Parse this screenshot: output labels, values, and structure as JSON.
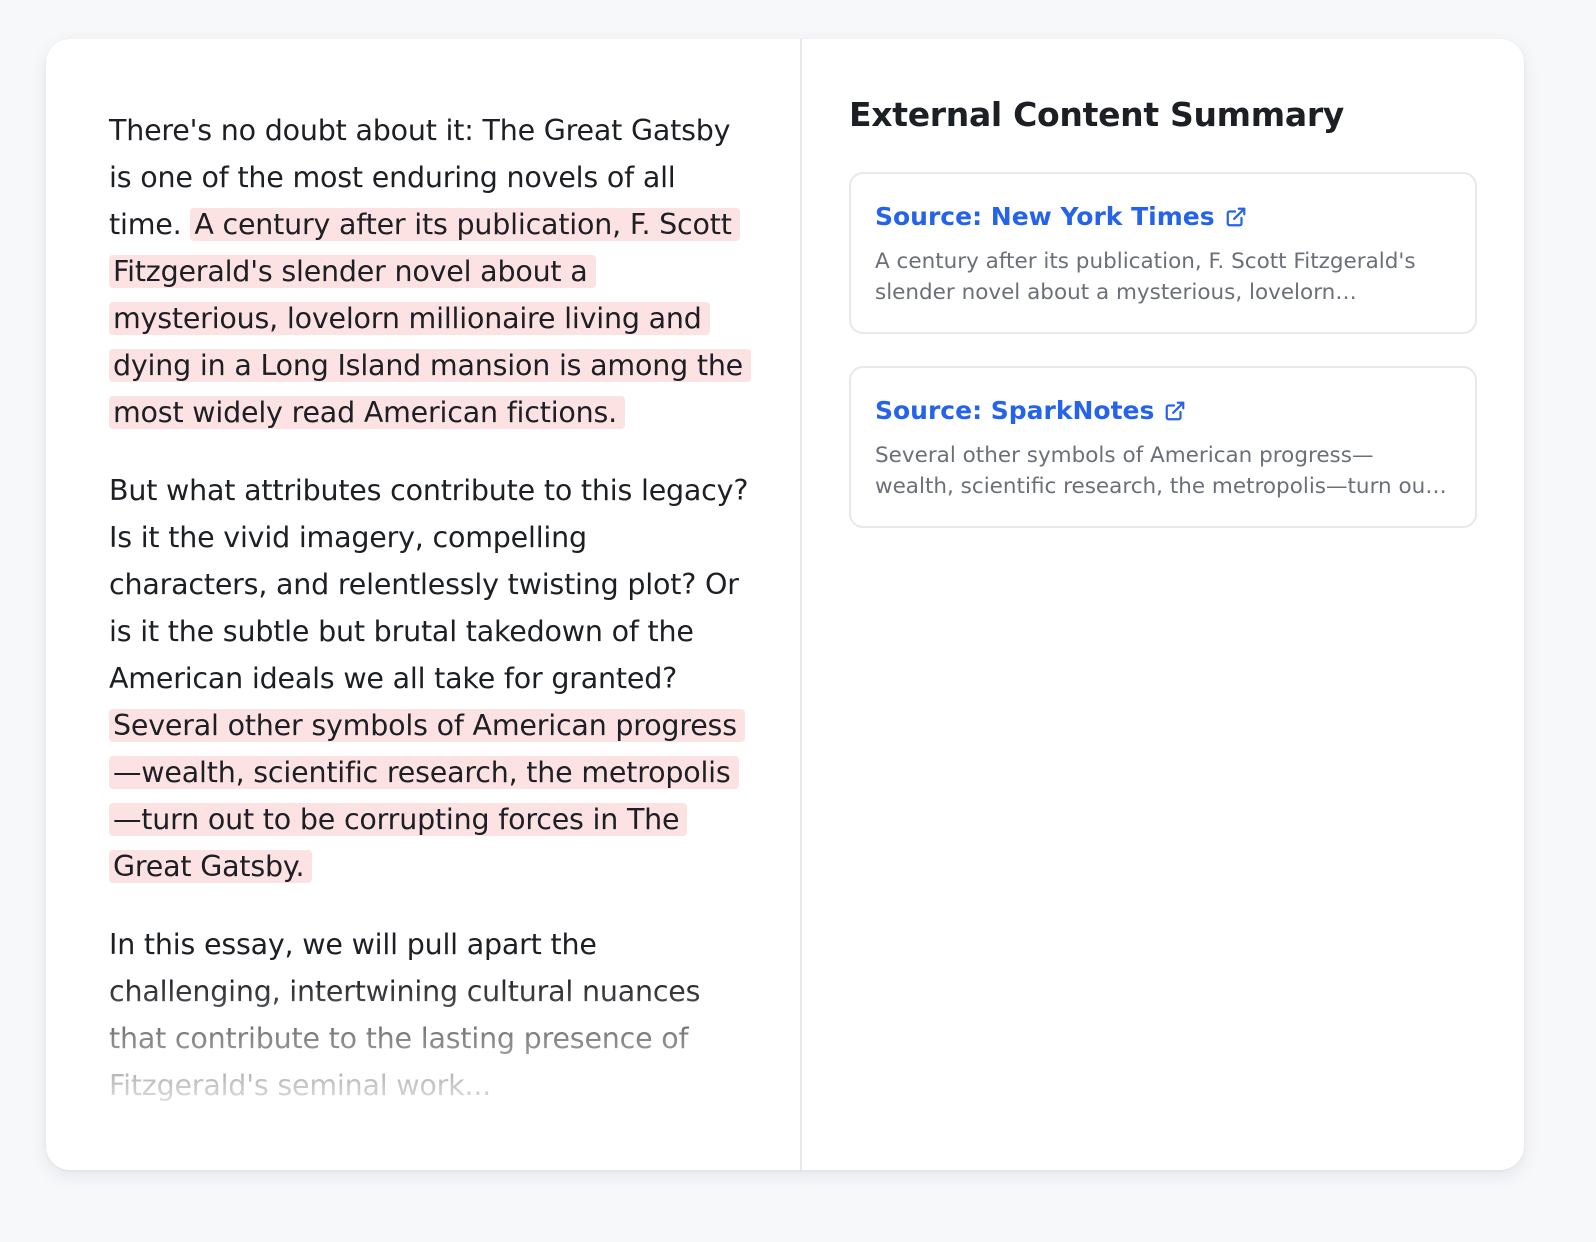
{
  "essay": {
    "p1_intro": "There's no doubt about it: The Great Gatsby is one of the most enduring novels of all time. ",
    "p1_highlight": "A century after its publication, F. Scott Fitzgerald's slender novel about a mysterious, lovelorn millionaire living and dying in a Long Island mansion is among the most widely read American fictions.",
    "p2_intro": "But what attributes contribute to this legacy? Is it the vivid imagery, compelling characters, and relentlessly twisting plot? Or is it the subtle but brutal takedown of the American ideals we all take for granted? ",
    "p2_highlight": "Several other symbols of American progress—wealth, scientific research, the metropolis—turn out to be corrupting forces in The Great Gatsby.",
    "p3": "In this essay, we will pull apart the challenging, intertwining cultural nuances that contribute to the lasting presence of Fitzgerald's seminal work..."
  },
  "summary": {
    "title": "External Content Summary",
    "sources": [
      {
        "label": "Source: New York Times",
        "icon": "external-link-icon",
        "snippet": "A century after its publication, F. Scott Fitzgerald's slender novel about a mysterious, lovelorn millionaire living and dying in a Long Island mansion is among the most widely read American fictions."
      },
      {
        "label": "Source: SparkNotes",
        "icon": "external-link-icon",
        "snippet": "Several other symbols of American progress—wealth, scientific research, the metropolis—turn out to be corrupting forces in The Great Gatsby."
      }
    ]
  },
  "colors": {
    "highlight": "#fde2e4",
    "link": "#2563eb",
    "text": "#1c1f23",
    "muted": "#6b7078"
  }
}
